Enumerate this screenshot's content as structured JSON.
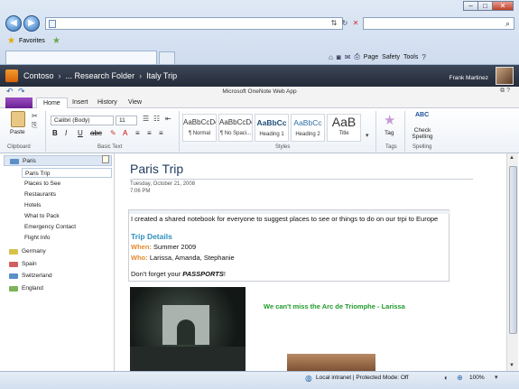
{
  "browser": {
    "window_controls": [
      "–",
      "□",
      "✕"
    ],
    "favorites_label": "Favorites",
    "commands": {
      "page": "Page",
      "safety": "Safety",
      "tools": "Tools"
    }
  },
  "app": {
    "breadcrumb": [
      "Contoso",
      "... Research Folder",
      "Italy Trip"
    ],
    "user_name": "Frank Martinez",
    "title": "Microsoft OneNote Web App"
  },
  "ribbon": {
    "file_tab": "",
    "tabs": [
      "Home",
      "Insert",
      "History",
      "View"
    ],
    "font_name": "Calibri (Body)",
    "font_size": "11",
    "paste_label": "Paste",
    "groups": {
      "clipboard": "Clipboard",
      "basic_text": "Basic Text",
      "styles": "Styles",
      "tags": "Tags",
      "spelling": "Spelling"
    },
    "styles": [
      {
        "preview": "AaBbCcDc",
        "label": "¶ Normal"
      },
      {
        "preview": "AaBbCcDc",
        "label": "¶ No Spaci..."
      },
      {
        "preview": "AaBbCc",
        "label": "Heading 1"
      },
      {
        "preview": "AaBbCc",
        "label": "Heading 2"
      },
      {
        "preview": "AaB",
        "label": "Title"
      }
    ],
    "tag_label": "Tag",
    "check_icon_text": "ABC",
    "check_label": "Check Spelling"
  },
  "sections": [
    {
      "name": "Paris",
      "color": "#5b8fc9"
    },
    {
      "name": "Germany",
      "color": "#d8c14a"
    },
    {
      "name": "Spain",
      "color": "#d06060"
    },
    {
      "name": "Switzerland",
      "color": "#5b8fc9"
    },
    {
      "name": "England",
      "color": "#7cb35c"
    }
  ],
  "pages": [
    "Paris Trip",
    "Places to See",
    "Restaurants",
    "Hotels",
    "What to Pack",
    "Emergency Contact",
    "Flight Info"
  ],
  "page": {
    "title": "Paris Trip",
    "date": "Tuesday, October 21, 2008",
    "time": "7:06 PM",
    "intro": "I created a shared notebook for everyone to suggest places to see or things to do on our trpi to Europe",
    "heading": "Trip Details",
    "when_label": "When:",
    "when_value": "Summer 2009",
    "who_label": "Who:",
    "who_value": "Larissa, Amanda, Stephanie",
    "passports_prefix": "Don't forget your ",
    "passports_word": "PASSPORTS",
    "passports_suffix": "!",
    "caption": "We can't miss the Arc de Triomphe - Larissa"
  },
  "status": {
    "zone": "Local intranet | Protected Mode: Off",
    "zoom": "100%"
  }
}
